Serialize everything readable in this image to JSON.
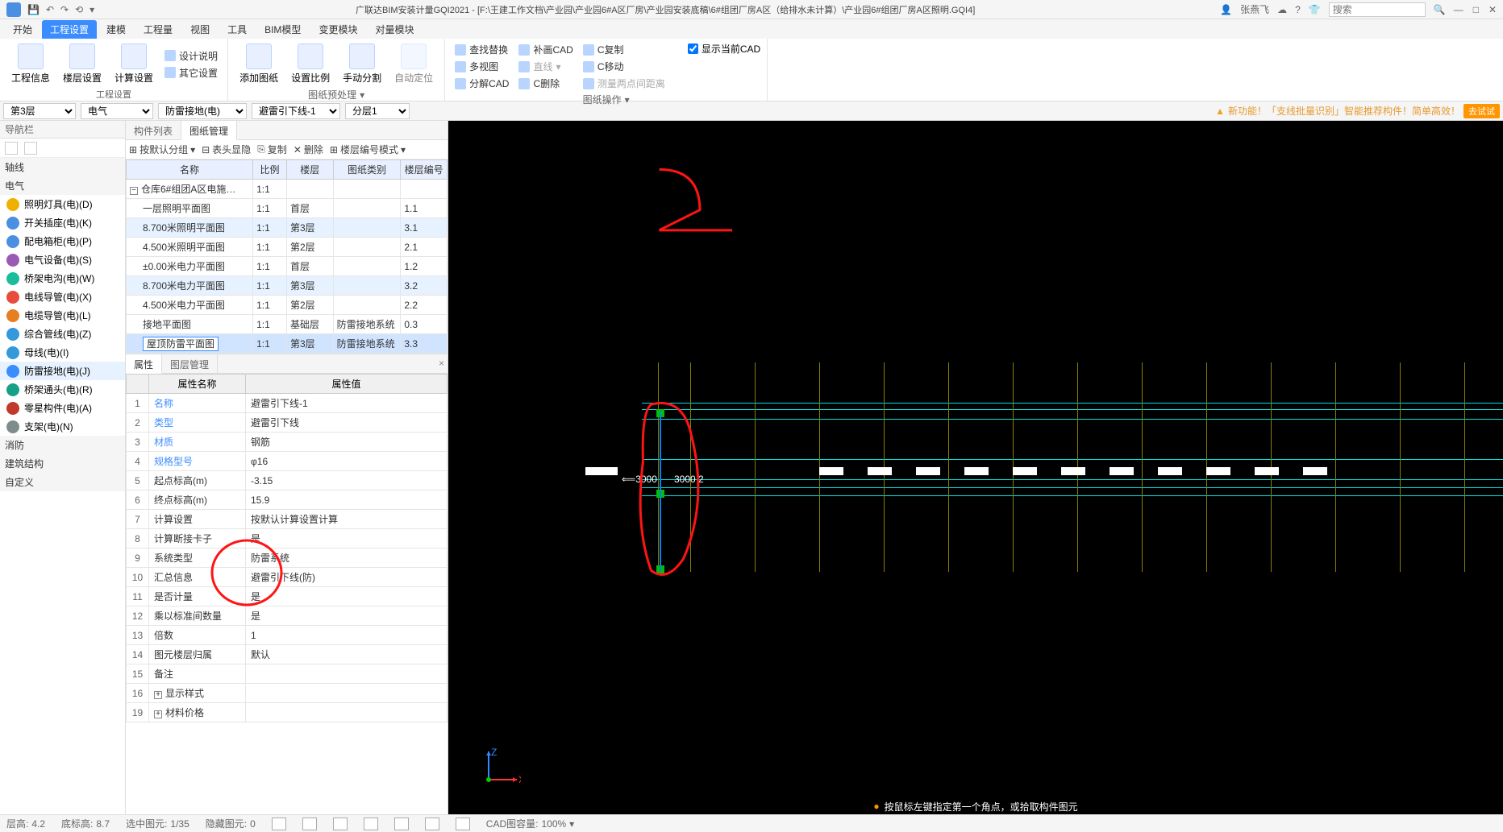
{
  "titlebar": {
    "app_title": "广联达BIM安装计量GQI2021 - [F:\\王建工作文档\\产业园\\产业园6#A区厂房\\产业园安装底稿\\6#组团厂房A区（给排水未计算）\\产业园6#组团厂房A区照明.GQI4]",
    "user": "张燕飞",
    "search_placeholder": "搜索"
  },
  "menu": {
    "tabs": [
      "开始",
      "工程设置",
      "建模",
      "工程量",
      "视图",
      "工具",
      "BIM模型",
      "变更模块",
      "对量模块"
    ],
    "active": 1
  },
  "ribbon": {
    "group1_label": "工程设置",
    "group2_label": "图纸预处理",
    "group3_label": "图纸操作",
    "btn_project_info": "工程信息",
    "btn_floor_setting": "楼层设置",
    "btn_calc_setting": "计算设置",
    "btn_design_desc": "设计说明",
    "btn_other_setting": "其它设置",
    "btn_add_drawing": "添加图纸",
    "btn_scale": "设置比例",
    "btn_manual_split": "手动分割",
    "btn_auto_locate": "自动定位",
    "btn_find_replace": "查找替换",
    "btn_multiview": "多视图",
    "btn_decompose_cad": "分解CAD",
    "btn_fill_cad": "补画CAD",
    "btn_line": "直线",
    "btn_c_delete": "C删除",
    "btn_c_copy": "C复制",
    "btn_c_move": "C移动",
    "btn_measure_dist": "测量两点间距离",
    "chk_show_cad": "显示当前CAD"
  },
  "context": {
    "floor": "第3层",
    "discipline": "电气",
    "category": "防雷接地(电)",
    "component": "避雷引下线-1",
    "layer": "分层1",
    "notice_prefix": "新功能！「支线批量识别」智能推荐构件！简单高效！",
    "badge": "去试试"
  },
  "nav": {
    "title": "导航栏",
    "cats": [
      "轴线",
      "电气",
      "消防",
      "建筑结构",
      "自定义"
    ],
    "items": [
      {
        "label": "照明灯具(电)(D)",
        "color": "#f0b000"
      },
      {
        "label": "开关插座(电)(K)",
        "color": "#4a90e2"
      },
      {
        "label": "配电箱柜(电)(P)",
        "color": "#4a90e2"
      },
      {
        "label": "电气设备(电)(S)",
        "color": "#9b59b6"
      },
      {
        "label": "桥架电沟(电)(W)",
        "color": "#1abc9c"
      },
      {
        "label": "电线导管(电)(X)",
        "color": "#e74c3c"
      },
      {
        "label": "电缆导管(电)(L)",
        "color": "#e67e22"
      },
      {
        "label": "综合管线(电)(Z)",
        "color": "#3498db"
      },
      {
        "label": "母线(电)(I)",
        "color": "#3498db"
      },
      {
        "label": "防雷接地(电)(J)",
        "color": "#3b8cff",
        "selected": true
      },
      {
        "label": "桥架通头(电)(R)",
        "color": "#16a085"
      },
      {
        "label": "零星构件(电)(A)",
        "color": "#c0392b"
      },
      {
        "label": "支架(电)(N)",
        "color": "#7f8c8d"
      }
    ]
  },
  "drawings_panel": {
    "tab_component": "构件列表",
    "tab_drawing": "图纸管理",
    "toolbar": {
      "group_by": "按默认分组",
      "header_toggle": "表头显隐",
      "copy": "复制",
      "delete": "删除",
      "floor_mode": "楼层编号模式"
    },
    "headers": [
      "名称",
      "比例",
      "楼层",
      "图纸类别",
      "楼层编号"
    ],
    "root": "仓库6#组团A区电施…",
    "root_scale": "1:1",
    "rows": [
      {
        "name": "一层照明平面图",
        "scale": "1:1",
        "floor": "首层",
        "cat": "",
        "num": "1.1"
      },
      {
        "name": "8.700米照明平面图",
        "scale": "1:1",
        "floor": "第3层",
        "cat": "",
        "num": "3.1",
        "hl": true
      },
      {
        "name": "4.500米照明平面图",
        "scale": "1:1",
        "floor": "第2层",
        "cat": "",
        "num": "2.1"
      },
      {
        "name": "±0.00米电力平面图",
        "scale": "1:1",
        "floor": "首层",
        "cat": "",
        "num": "1.2"
      },
      {
        "name": "8.700米电力平面图",
        "scale": "1:1",
        "floor": "第3层",
        "cat": "",
        "num": "3.2",
        "hl": true
      },
      {
        "name": "4.500米电力平面图",
        "scale": "1:1",
        "floor": "第2层",
        "cat": "",
        "num": "2.2"
      },
      {
        "name": "接地平面图",
        "scale": "1:1",
        "floor": "基础层",
        "cat": "防雷接地系统",
        "num": "0.3"
      },
      {
        "name": "屋顶防雷平面图",
        "scale": "1:1",
        "floor": "第3层",
        "cat": "防雷接地系统",
        "num": "3.3",
        "sel": true
      }
    ]
  },
  "props": {
    "tab_props": "属性",
    "tab_layer": "图层管理",
    "header_name": "属性名称",
    "header_value": "属性值",
    "rows": [
      {
        "n": "1",
        "k": "名称",
        "v": "避雷引下线-1",
        "link": true
      },
      {
        "n": "2",
        "k": "类型",
        "v": "避雷引下线",
        "link": true
      },
      {
        "n": "3",
        "k": "材质",
        "v": "钢筋",
        "link": true
      },
      {
        "n": "4",
        "k": "规格型号",
        "v": "φ16",
        "link": true
      },
      {
        "n": "5",
        "k": "起点标高(m)",
        "v": "-3.15"
      },
      {
        "n": "6",
        "k": "终点标高(m)",
        "v": "15.9"
      },
      {
        "n": "7",
        "k": "计算设置",
        "v": "按默认计算设置计算"
      },
      {
        "n": "8",
        "k": "计算断接卡子",
        "v": "是"
      },
      {
        "n": "9",
        "k": "系统类型",
        "v": "防雷系统"
      },
      {
        "n": "10",
        "k": "汇总信息",
        "v": "避雷引下线(防)"
      },
      {
        "n": "11",
        "k": "是否计量",
        "v": "是"
      },
      {
        "n": "12",
        "k": "乘以标准间数量",
        "v": "是"
      },
      {
        "n": "13",
        "k": "倍数",
        "v": "1"
      },
      {
        "n": "14",
        "k": "图元楼层归属",
        "v": "默认"
      },
      {
        "n": "15",
        "k": "备注",
        "v": ""
      },
      {
        "n": "16",
        "k": "显示样式",
        "v": "",
        "expand": true
      },
      {
        "n": "19",
        "k": "材料价格",
        "v": "",
        "expand": true
      }
    ]
  },
  "viewport": {
    "hint": "按鼠标左键指定第一个角点，或拾取构件图元",
    "dim1": "3000",
    "dim2": "3000",
    "anno_num": "2",
    "axis_x": "X",
    "axis_z": "Z"
  },
  "status": {
    "s1_label": "层高:",
    "s1_val": "4.2",
    "s2_label": "底标高:",
    "s2_val": "8.7",
    "s3_label": "选中图元:",
    "s3_val": "1/35",
    "s4_label": "隐藏图元:",
    "s4_val": "0",
    "s5_label": "CAD图容量:",
    "s5_val": "100%"
  }
}
